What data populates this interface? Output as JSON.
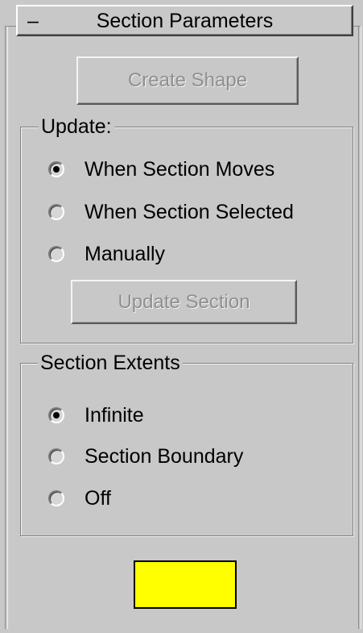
{
  "rollout": {
    "toggle": "–",
    "title": "Section Parameters"
  },
  "buttons": {
    "create_shape": "Create Shape",
    "update_section": "Update Section"
  },
  "update_group": {
    "label": "Update:",
    "options": [
      {
        "label": "When Section Moves",
        "selected": true
      },
      {
        "label": "When Section Selected",
        "selected": false
      },
      {
        "label": "Manually",
        "selected": false
      }
    ]
  },
  "extents_group": {
    "label": "Section Extents",
    "options": [
      {
        "label": "Infinite",
        "selected": true
      },
      {
        "label": "Section Boundary",
        "selected": false
      },
      {
        "label": "Off",
        "selected": false
      }
    ]
  },
  "color_swatch": {
    "color": "#ffff00"
  }
}
